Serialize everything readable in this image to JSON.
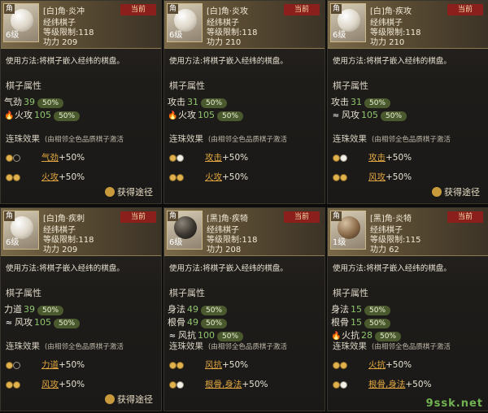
{
  "common": {
    "usage": "使用方法:将棋子嵌入经纬的棋盘。",
    "attr_title": "棋子属性",
    "bonus_title": "连珠效果",
    "bonus_note": "(由相邻全色品质棋子激活",
    "acquire": "获得途径",
    "current": "当前"
  },
  "cards": [
    {
      "name": "[白]角·炎冲",
      "sub": "经纬棋子",
      "req": "等级限制:118",
      "power": "功力 209",
      "thumb_tag": "角",
      "level": "6级",
      "stone": "white",
      "attrs": [
        {
          "icon": "",
          "label": "气劲",
          "value": "39",
          "pct": "50%"
        },
        {
          "icon": "flame-icon",
          "label": "火攻",
          "value": "105",
          "pct": "50%"
        }
      ],
      "bonuses": [
        {
          "dots": [
            "g",
            "b"
          ],
          "text": "气劲",
          "plus": "+50%"
        },
        {
          "dots": [
            "g",
            "g"
          ],
          "text": "火攻",
          "plus": "+50%"
        }
      ],
      "show_acquire": true
    },
    {
      "name": "[白]角·炎攻",
      "sub": "经纬棋子",
      "req": "等级限制:118",
      "power": "功力 210",
      "thumb_tag": "角",
      "level": "6级",
      "stone": "white",
      "attrs": [
        {
          "icon": "",
          "label": "攻击",
          "value": "31",
          "pct": "50%"
        },
        {
          "icon": "flame-icon",
          "label": "火攻",
          "value": "105",
          "pct": "50%"
        }
      ],
      "bonuses": [
        {
          "dots": [
            "g",
            "w"
          ],
          "text": "攻击",
          "plus": "+50%"
        },
        {
          "dots": [
            "g",
            "g"
          ],
          "text": "火攻",
          "plus": "+50%"
        }
      ],
      "show_acquire": false
    },
    {
      "name": "[白]角·疾攻",
      "sub": "经纬棋子",
      "req": "等级限制:118",
      "power": "功力 210",
      "thumb_tag": "角",
      "level": "6级",
      "stone": "white",
      "attrs": [
        {
          "icon": "",
          "label": "攻击",
          "value": "31",
          "pct": "50%"
        },
        {
          "icon": "wind-icon",
          "label": "风攻",
          "value": "105",
          "pct": "50%"
        }
      ],
      "bonuses": [
        {
          "dots": [
            "g",
            "w"
          ],
          "text": "攻击",
          "plus": "+50%"
        },
        {
          "dots": [
            "g",
            "g"
          ],
          "text": "风攻",
          "plus": "+50%"
        }
      ],
      "show_acquire": true
    },
    {
      "name": "[白]角·疾刺",
      "sub": "经纬棋子",
      "req": "等级限制:118",
      "power": "功力 209",
      "thumb_tag": "角",
      "level": "6级",
      "stone": "white",
      "attrs": [
        {
          "icon": "",
          "label": "力道",
          "value": "39",
          "pct": "50%"
        },
        {
          "icon": "wind-icon",
          "label": "风攻",
          "value": "105",
          "pct": "50%"
        }
      ],
      "bonuses": [
        {
          "dots": [
            "g",
            "b"
          ],
          "text": "力道",
          "plus": "+50%"
        },
        {
          "dots": [
            "g",
            "g"
          ],
          "text": "风攻",
          "plus": "+50%"
        }
      ],
      "show_acquire": true
    },
    {
      "name": "[黑]角·疾犄",
      "sub": "经纬棋子",
      "req": "等级限制:118",
      "power": "功力 208",
      "thumb_tag": "角",
      "level": "6级",
      "stone": "black",
      "attrs": [
        {
          "icon": "",
          "label": "身法",
          "value": "49",
          "pct": "50%"
        },
        {
          "icon": "",
          "label": "根骨",
          "value": "49",
          "pct": "50%"
        },
        {
          "icon": "wind-icon",
          "label": "风抗",
          "value": "100",
          "pct": "50%"
        }
      ],
      "bonuses": [
        {
          "dots": [
            "g",
            "g"
          ],
          "text": "风抗",
          "plus": "+50%"
        },
        {
          "dots": [
            "g",
            "w"
          ],
          "text": "根骨,身法",
          "plus": "+50%"
        }
      ],
      "show_acquire": false
    },
    {
      "name": "[黑]角·炎犄",
      "sub": "经纬棋子",
      "req": "等级限制:115",
      "power": "功力 62",
      "thumb_tag": "角",
      "level": "1级",
      "stone": "brown",
      "attrs": [
        {
          "icon": "",
          "label": "身法",
          "value": "15",
          "pct": "50%"
        },
        {
          "icon": "",
          "label": "根骨",
          "value": "15",
          "pct": "50%"
        },
        {
          "icon": "flame-icon",
          "label": "火抗",
          "value": "28",
          "pct": "50%"
        }
      ],
      "bonuses": [
        {
          "dots": [
            "g",
            "g"
          ],
          "text": "火抗",
          "plus": "+50%"
        },
        {
          "dots": [
            "g",
            "w"
          ],
          "text": "根骨,身法",
          "plus": "+50%"
        }
      ],
      "show_acquire": false
    }
  ],
  "watermark": "9ssk.net"
}
